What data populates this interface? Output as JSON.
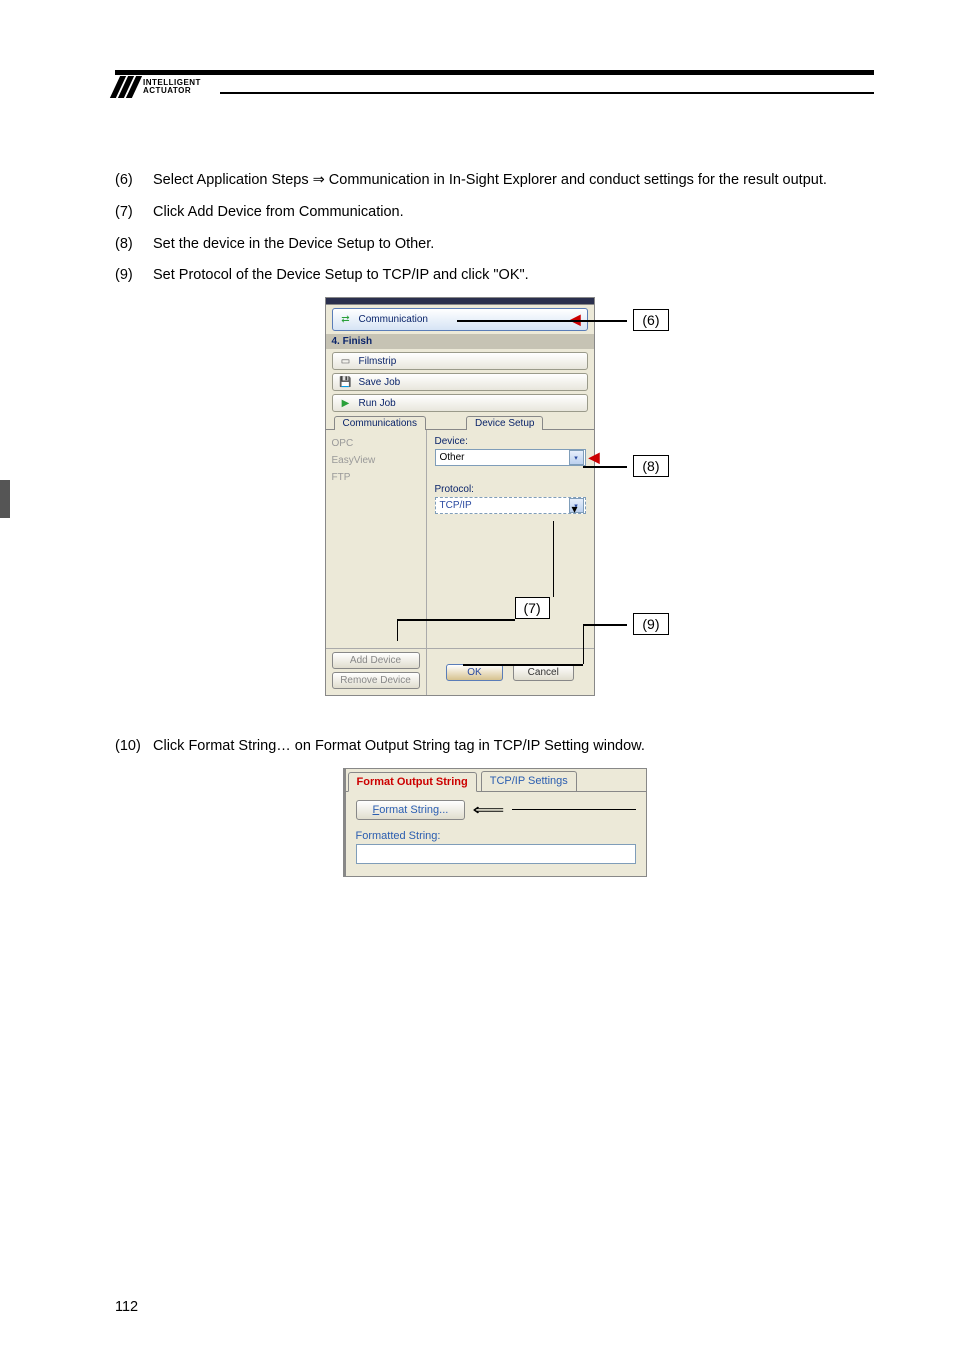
{
  "logo": {
    "line1": "INTELLIGENT",
    "line2": "ACTUATOR"
  },
  "instructions": [
    {
      "num": "(6)",
      "text_pre": "Select Application Steps ",
      "arrow": "⇒",
      "text_post": " Communication in In-Sight Explorer and conduct settings for the result output."
    },
    {
      "num": "(7)",
      "text_pre": "Click Add Device from Communication.",
      "arrow": "",
      "text_post": ""
    },
    {
      "num": "(8)",
      "text_pre": "Set the device in the Device Setup to Other.",
      "arrow": "",
      "text_post": ""
    },
    {
      "num": "(9)",
      "text_pre": "Set Protocol of the Device Setup to TCP/IP and click \"OK\".",
      "arrow": "",
      "text_post": ""
    }
  ],
  "instr10": {
    "num": "(10)",
    "text": "Click Format String… on Format Output String tag in TCP/IP Setting window."
  },
  "dlg": {
    "comm_btn": "Communication",
    "section4": "4. Finish",
    "filmstrip": "Filmstrip",
    "savejob": "Save Job",
    "runjob": "Run Job",
    "tab_comm": "Communications",
    "tab_dev": "Device Setup",
    "opc": "OPC",
    "easyview": "EasyView",
    "ftp": "FTP",
    "lbl_device": "Device:",
    "val_device": "Other",
    "lbl_protocol": "Protocol:",
    "val_protocol": "TCP/IP",
    "add_device": "Add Device",
    "remove_device": "Remove Device",
    "ok": "OK",
    "cancel": "Cancel"
  },
  "callouts": {
    "c6": "(6)",
    "c7": "(7)",
    "c8": "(8)",
    "c9": "(9)"
  },
  "fmt": {
    "tab_active": "Format Output String",
    "tab_inactive": "TCP/IP Settings",
    "btn_prefix": "F",
    "btn_rest": "ormat String...",
    "lbl_formatted": "Formatted String:"
  },
  "page_number": "112"
}
